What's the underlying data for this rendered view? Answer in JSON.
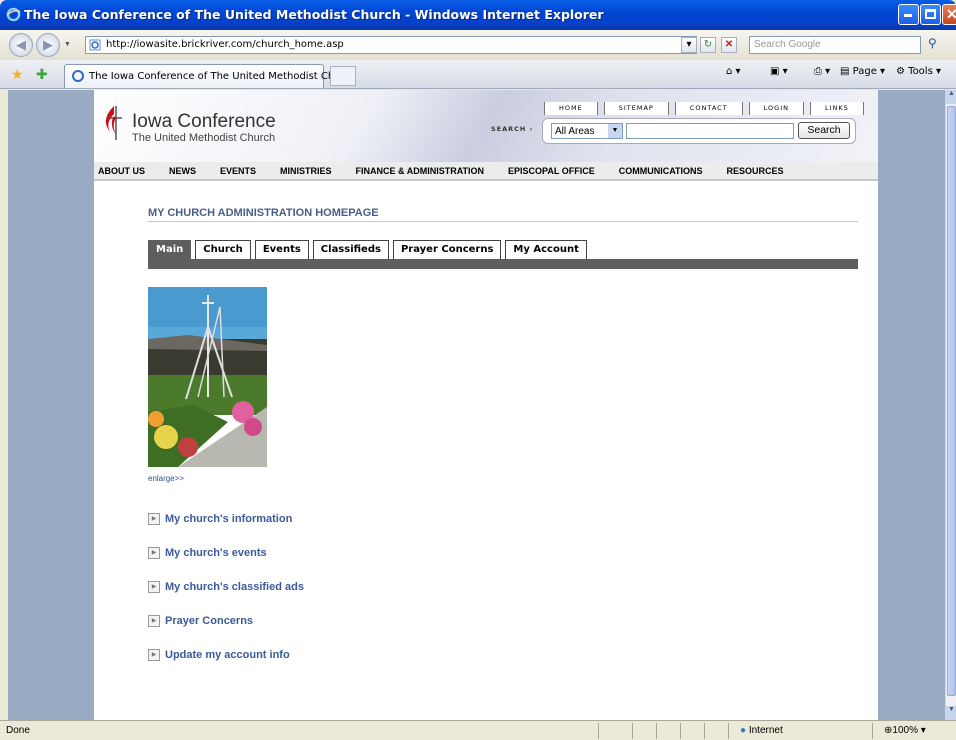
{
  "window": {
    "title": "The Iowa Conference of The United Methodist Church - Windows Internet Explorer"
  },
  "addressbar": {
    "url": "http://iowasite.brickriver.com/church_home.asp",
    "search_placeholder": "Search Google"
  },
  "tabbar": {
    "tab_label": "The Iowa Conference of The United Methodist Church",
    "page_menu": "Page",
    "tools_menu": "Tools"
  },
  "site": {
    "brand_line1": "Iowa Conference",
    "brand_line2": "The United Methodist Church",
    "top_links": [
      "HOME",
      "SITEMAP",
      "CONTACT",
      "LOGIN",
      "LINKS"
    ],
    "search_label": "SEARCH",
    "search_scope": "All Areas",
    "search_button": "Search",
    "main_nav": [
      "ABOUT US",
      "NEWS",
      "EVENTS",
      "MINISTRIES",
      "FINANCE & ADMINISTRATION",
      "EPISCOPAL OFFICE",
      "COMMUNICATIONS",
      "RESOURCES"
    ]
  },
  "content": {
    "section_title": "MY CHURCH ADMINISTRATION HOMEPAGE",
    "tabs": [
      "Main",
      "Church",
      "Events",
      "Classifieds",
      "Prayer Concerns",
      "My Account"
    ],
    "active_tab": "Main",
    "enlarge_label": "enlarge>>",
    "links": [
      "My church's information",
      "My church's events",
      "My church's classified ads",
      "Prayer Concerns",
      "Update my account info"
    ]
  },
  "statusbar": {
    "status": "Done",
    "zone": "Internet",
    "zoom": "100%"
  },
  "colors": {
    "titlebar": "#0046d5",
    "page_bg": "#99aac3",
    "link": "#3a5a9a",
    "tab_active": "#5d5f5e",
    "section_title": "#4a5f8a"
  }
}
